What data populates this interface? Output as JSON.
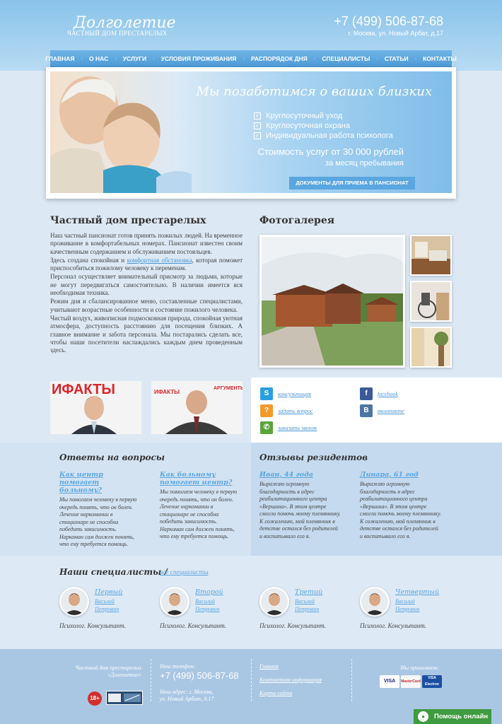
{
  "header": {
    "logo_title": "Долголетие",
    "logo_subtitle": "ЧАСТНЫЙ ДОМ ПРЕСТАРЕЛЫХ",
    "phone": "+7 (499) 506-87-68",
    "address": "г. Москва, ул. Новый Арбат, д.17"
  },
  "nav": {
    "items": [
      "ГЛАВНАЯ",
      "О НАС",
      "УСЛУГИ",
      "УСЛОВИЯ ПРОЖИВАНИЯ",
      "РАСПОРЯДОК ДНЯ",
      "СПЕЦИАЛИСТЫ",
      "СТАТЬИ",
      "КОНТАКТЫ"
    ]
  },
  "banner": {
    "title": "Мы позаботимся о ваших близких",
    "features": [
      "Круглосуточный уход",
      "Круглосуточная охрана",
      "Индивидуальная работа психолога"
    ],
    "price": "Стоимость услуг от 30 000 рублей",
    "price_sub": "за месяц пребывания",
    "button": "ДОКУМЕНТЫ ДЛЯ ПРИЕМА В ПАНСИОНАТ"
  },
  "about": {
    "title": "Частный дом престарелых",
    "p1": "Наш частный пансионат готов принять пожилых людей. На временное проживание в комфортабельных номерах. Пансионат известен своим качественным содержанием и обслуживанием постояльцев.",
    "p2_before": "Здесь создана спокойная и ",
    "p2_link": "комфортная обстановка",
    "p2_after": ", которая поможет приспособиться пожилому человеку к переменам.",
    "p3": "Персонал осуществляет внимательный присмотр за людьми, которые не могут передвигаться самостоятельно. В наличии имеется вся необходимая техника.",
    "p4": "Режим дня и сбалансированное меню, составленные специалистами, учитывают возрастные особенности и состояние пожилого человека.",
    "p5": "Чистый воздух, живописная подмосковная природа, спокойная уютная атмосфера, доступность расстоянию для посещения близких. А главное внимание и забота персонала. Мы постарались сделать все, чтобы наши посетители наслаждались каждым днем проведенным здесь."
  },
  "gallery": {
    "title": "Фотогалерея"
  },
  "social": {
    "items": [
      {
        "label": "консультация",
        "icon": "skype-icon",
        "color": "#2a9fe0"
      },
      {
        "label": "facebook",
        "icon": "facebook-icon",
        "color": "#3b5998"
      },
      {
        "label": "задать вопрос",
        "icon": "question-icon",
        "color": "#f39a2b"
      },
      {
        "label": "вконтакте",
        "icon": "vk-icon",
        "color": "#4c75a3"
      },
      {
        "label": "заказать звонок",
        "icon": "phone-icon",
        "color": "#5aa53a"
      }
    ]
  },
  "qa": {
    "title": "Ответы на вопросы",
    "items": [
      {
        "q": "Как центр помогает больному?",
        "a": "Мы помогаем человеку в первую очередь понять, что он болен. Лечение наркомании в стационаре не способна победить зависимость. Наркоман сам должен понять, что ему требуется помощь."
      },
      {
        "q": "Как больному помогает центр?",
        "a": "Мы помогаем человеку в первую очередь понять, что он болен. Лечение наркомании в стационаре не способна победить зависимость. Наркоман сам должен понять, что ему требуется помощь."
      }
    ]
  },
  "reviews": {
    "title": "Отзывы резидентов",
    "items": [
      {
        "name": "Иван, 44 года",
        "text": "Выражаю огромную благодарность в адрес реабилитационного центра «Вершина». В этом центре смогли помочь моему племяннику. К сожалению, мой племянник в детстве остался без родителей и воспитывало его я."
      },
      {
        "name": "Динара, 61 год",
        "text": "Выражаю огромную благодарность в адрес реабилитационного центра «Вершина». В этом центре смогли помочь моему племяннику. К сожалению, мой племянник в детстве остался без родителей и воспитывало его я."
      }
    ]
  },
  "specialists": {
    "title": "Наши специалисты /",
    "all_link": "все специалисты",
    "items": [
      {
        "name": "Первый",
        "first": "Василий",
        "patronymic": "Петрович",
        "role": "Психолог. Консультант."
      },
      {
        "name": "Второй",
        "first": "Василий",
        "patronymic": "Петрович",
        "role": "Психолог. Консультант."
      },
      {
        "name": "Третий",
        "first": "Василий",
        "patronymic": "Петрович",
        "role": "Психолог. Консультант."
      },
      {
        "name": "Четвертый",
        "first": "Василий",
        "patronymic": "Петрович",
        "role": "Психолог. Консультант."
      }
    ]
  },
  "footer": {
    "org_line1": "Частный дом престарелых",
    "org_line2": "«Долголетие»",
    "age": "18+",
    "phone_label": "Наш телефон:",
    "phone": "+7 (499) 506-87-68",
    "address_label": "Наш адрес: г. Москва,",
    "address_line2": "ул. Новый Арбат, д.17",
    "links": [
      "Главная",
      "Контактная информация",
      "Карта сайта"
    ],
    "payments_label": "Мы принимаем:",
    "cards": [
      "VISA",
      "MasterCard",
      "VISA Electron"
    ]
  },
  "help_button": "Помощь онлайн"
}
